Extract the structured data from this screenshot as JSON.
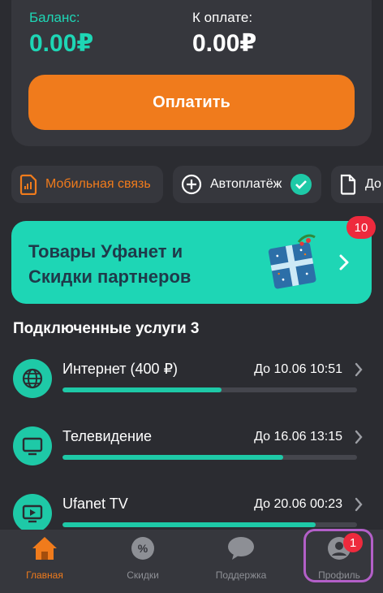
{
  "balance": {
    "balance_label": "Баланс:",
    "balance_value": "0.00₽",
    "due_label": "К оплате:",
    "due_value": "0.00₽",
    "pay_button": "Оплатить"
  },
  "chips": [
    {
      "label": "Мобильная связь",
      "icon": "sim-card-icon"
    },
    {
      "label": "Автоплатёж",
      "icon": "plus-circle-icon",
      "status_icon": "check-circle-icon"
    },
    {
      "label": "До",
      "icon": "document-icon"
    }
  ],
  "promo": {
    "title": "Товары Уфанет и Скидки партнеров",
    "badge": "10",
    "icon": "gift-box-icon"
  },
  "services": {
    "title": "Подключенные услуги 3",
    "items": [
      {
        "name": "Интернет (400 ₽)",
        "date": "До 10.06 10:51",
        "progress": 0.54,
        "icon": "globe-icon"
      },
      {
        "name": "Телевидение",
        "date": "До 16.06 13:15",
        "progress": 0.75,
        "icon": "tv-icon"
      },
      {
        "name": "Ufanet TV",
        "date": "До 20.06 00:23",
        "progress": 0.86,
        "icon": "play-screen-icon"
      }
    ]
  },
  "nav": {
    "items": [
      {
        "label": "Главная",
        "icon": "home-icon",
        "active": true
      },
      {
        "label": "Скидки",
        "icon": "percent-icon",
        "active": false
      },
      {
        "label": "Поддержка",
        "icon": "chat-icon",
        "active": false
      },
      {
        "label": "Профиль",
        "icon": "profile-icon",
        "active": false,
        "badge": "1"
      }
    ]
  },
  "colors": {
    "accent_orange": "#f07b1c",
    "accent_teal": "#1ed6b5",
    "background": "#2b2c31",
    "card": "#36373d",
    "badge_red": "#ee2a3d",
    "highlight": "#b35fc8"
  }
}
